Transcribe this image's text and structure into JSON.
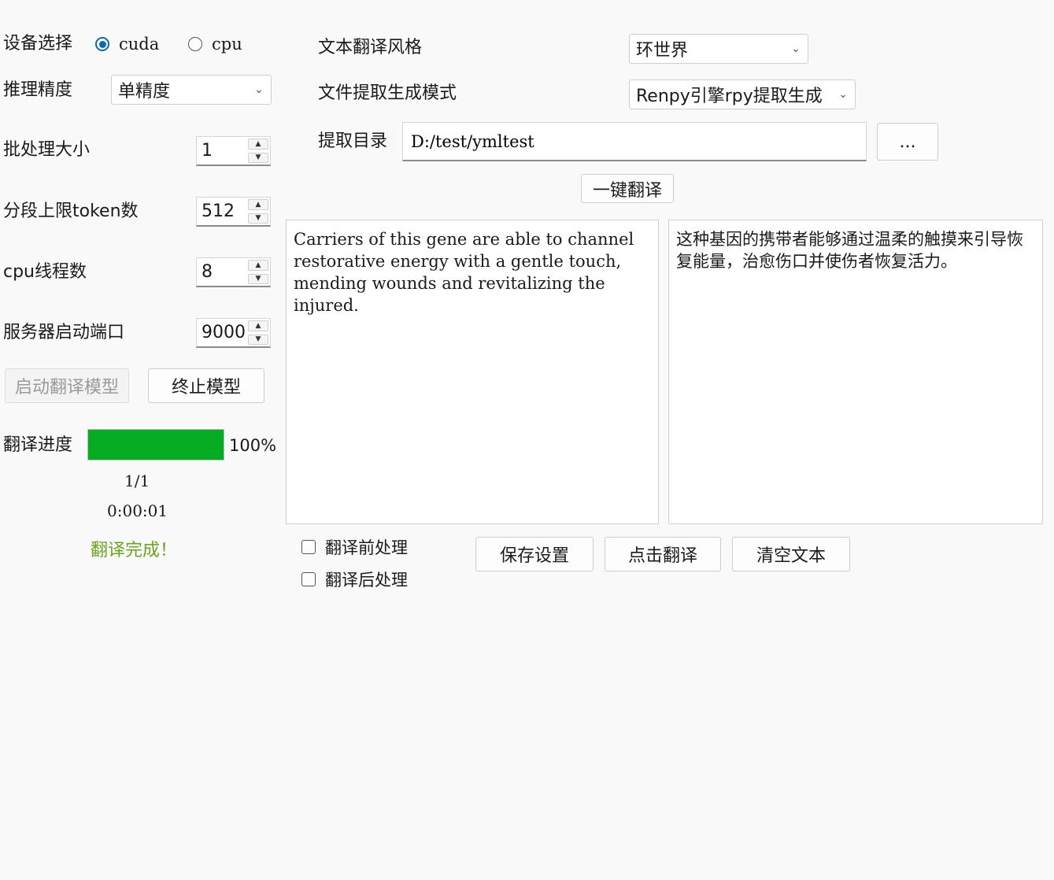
{
  "device": {
    "label": "设备选择",
    "options": [
      "cuda",
      "cpu"
    ],
    "selected": "cuda"
  },
  "precision": {
    "label": "推理精度",
    "value": "单精度"
  },
  "batch_size": {
    "label": "批处理大小",
    "value": "1"
  },
  "segment_tokens": {
    "label": "分段上限token数",
    "value": "512"
  },
  "cpu_threads": {
    "label": "cpu线程数",
    "value": "8"
  },
  "server_port": {
    "label": "服务器启动端口",
    "value": "9000"
  },
  "model_buttons": {
    "start": "启动翻译模型",
    "stop": "终止模型"
  },
  "progress": {
    "label": "翻译进度",
    "percent": 100,
    "percent_text": "100%",
    "count": "1/1",
    "elapsed": "0:00:01",
    "status": "翻译完成！",
    "fill_color": "#06ad22",
    "status_color": "#6aa51e"
  },
  "style": {
    "label": "文本翻译风格",
    "value": "环世界"
  },
  "extract_mode": {
    "label": "文件提取生成模式",
    "value": "Renpy引擎rpy提取生成"
  },
  "extract_dir": {
    "label": "提取目录",
    "value": "D:/test/ymltest",
    "browse": "..."
  },
  "one_click": "一键翻译",
  "source_text": "Carriers of this gene are able to channel restorative energy with a gentle touch, mending wounds and revitalizing the injured.",
  "target_text": "这种基因的携带者能够通过温柔的触摸来引导恢复能量，治愈伤口并使伤者恢复活力。",
  "options": {
    "pre": "翻译前处理",
    "post": "翻译后处理"
  },
  "actions": {
    "save": "保存设置",
    "translate": "点击翻译",
    "clear": "清空文本"
  },
  "accent_color": "#0a67c2"
}
